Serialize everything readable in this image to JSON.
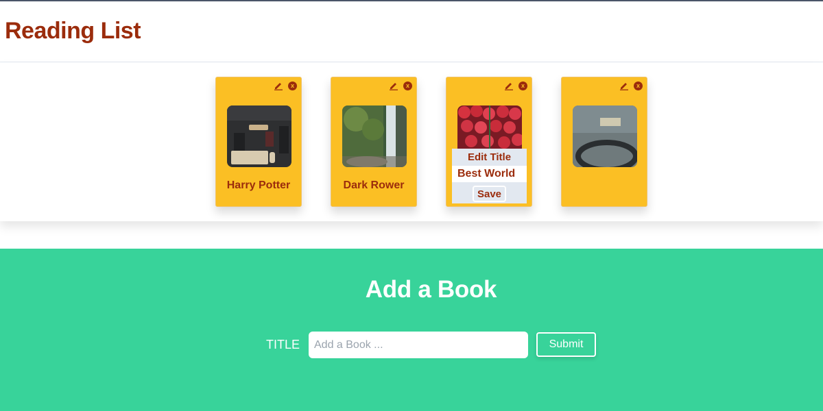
{
  "header": {
    "title": "Reading List"
  },
  "books": [
    {
      "title": "Harry Potter",
      "image": "desk-keyboard-photo"
    },
    {
      "title": "Dark Rower",
      "image": "waterfall-photo"
    },
    {
      "title": "",
      "image": "strawberries-photo"
    },
    {
      "title": "",
      "image": "car-dashboard-photo"
    }
  ],
  "edit_panel": {
    "heading": "Edit Title",
    "value": "Best World",
    "save_label": "Save"
  },
  "icons": {
    "edit": "pencil-icon",
    "delete": "close-icon",
    "delete_glyph": "x"
  },
  "form": {
    "heading": "Add a Book",
    "label": "TITLE",
    "placeholder": "Add a Book ...",
    "submit_label": "Submit"
  },
  "colors": {
    "brand_text": "#9b2c0c",
    "card_bg": "#fbbf24",
    "form_bg": "#38d39a"
  }
}
